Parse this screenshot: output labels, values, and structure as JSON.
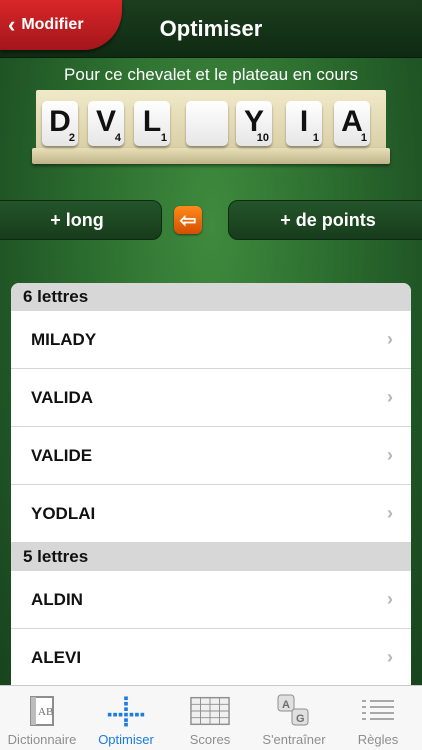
{
  "header": {
    "back_label": "Modifier",
    "title": "Optimiser"
  },
  "subtitle": "Pour ce chevalet et le plateau en cours",
  "rack": [
    {
      "letter": "D",
      "points": "2"
    },
    {
      "letter": "V",
      "points": "4"
    },
    {
      "letter": "L",
      "points": "1"
    },
    {
      "letter": "",
      "points": ""
    },
    {
      "letter": "Y",
      "points": "10"
    },
    {
      "letter": "I",
      "points": "1"
    },
    {
      "letter": "A",
      "points": "1"
    }
  ],
  "sort": {
    "long_label": "+ long",
    "points_label": "+ de points"
  },
  "sections": [
    {
      "header": "6 lettres",
      "words": [
        "MILADY",
        "VALIDA",
        "VALIDE",
        "YODLAI"
      ]
    },
    {
      "header": "5 lettres",
      "words": [
        "ALDIN",
        "ALEVI"
      ]
    }
  ],
  "tabs": [
    {
      "label": "Dictionnaire",
      "icon": "dictionary-icon"
    },
    {
      "label": "Optimiser",
      "icon": "optimize-icon"
    },
    {
      "label": "Scores",
      "icon": "scores-grid-icon"
    },
    {
      "label": "S'entraîner",
      "icon": "train-tiles-icon"
    },
    {
      "label": "Règles",
      "icon": "rules-list-icon"
    }
  ],
  "colors": {
    "back_button": "#c41e23",
    "accent": "#1a7be0",
    "swap_icon": "#f06a0a"
  }
}
